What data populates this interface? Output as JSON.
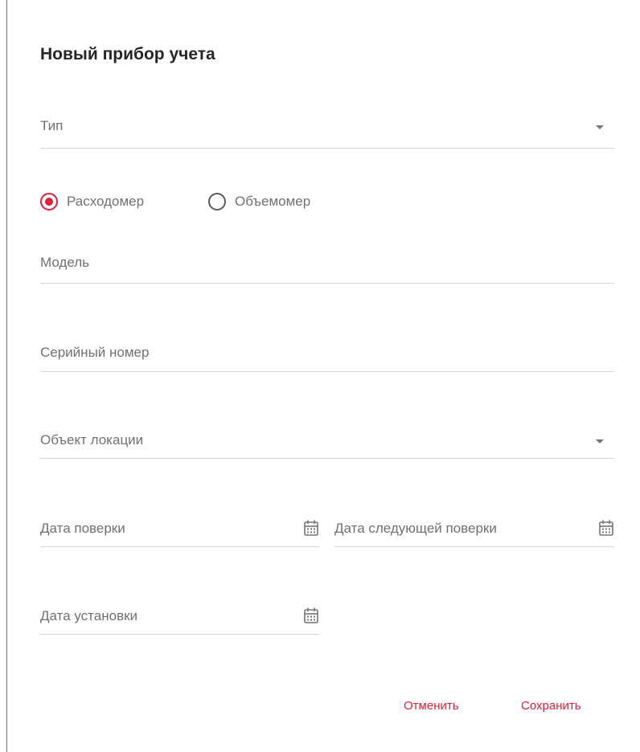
{
  "dialog": {
    "title": "Новый прибор учета",
    "fields": {
      "type": {
        "label": "Тип"
      },
      "model": {
        "label": "Модель"
      },
      "serial": {
        "label": "Серийный номер"
      },
      "location": {
        "label": "Объект локации"
      },
      "verification_date": {
        "label": "Дата поверки"
      },
      "next_verification_date": {
        "label": "Дата следующей поверки"
      },
      "install_date": {
        "label": "Дата установки"
      }
    },
    "meter_kind": {
      "options": [
        {
          "label": "Расходомер",
          "selected": true
        },
        {
          "label": "Объемомер",
          "selected": false
        }
      ]
    },
    "actions": {
      "cancel": "Отменить",
      "save": "Сохранить"
    }
  },
  "icons": {
    "dropdown": "chevron-down-icon",
    "calendar": "calendar-icon"
  },
  "colors": {
    "accent": "#e31e37",
    "label": "#707070",
    "title": "#262626",
    "divider": "#d6d6d6"
  }
}
